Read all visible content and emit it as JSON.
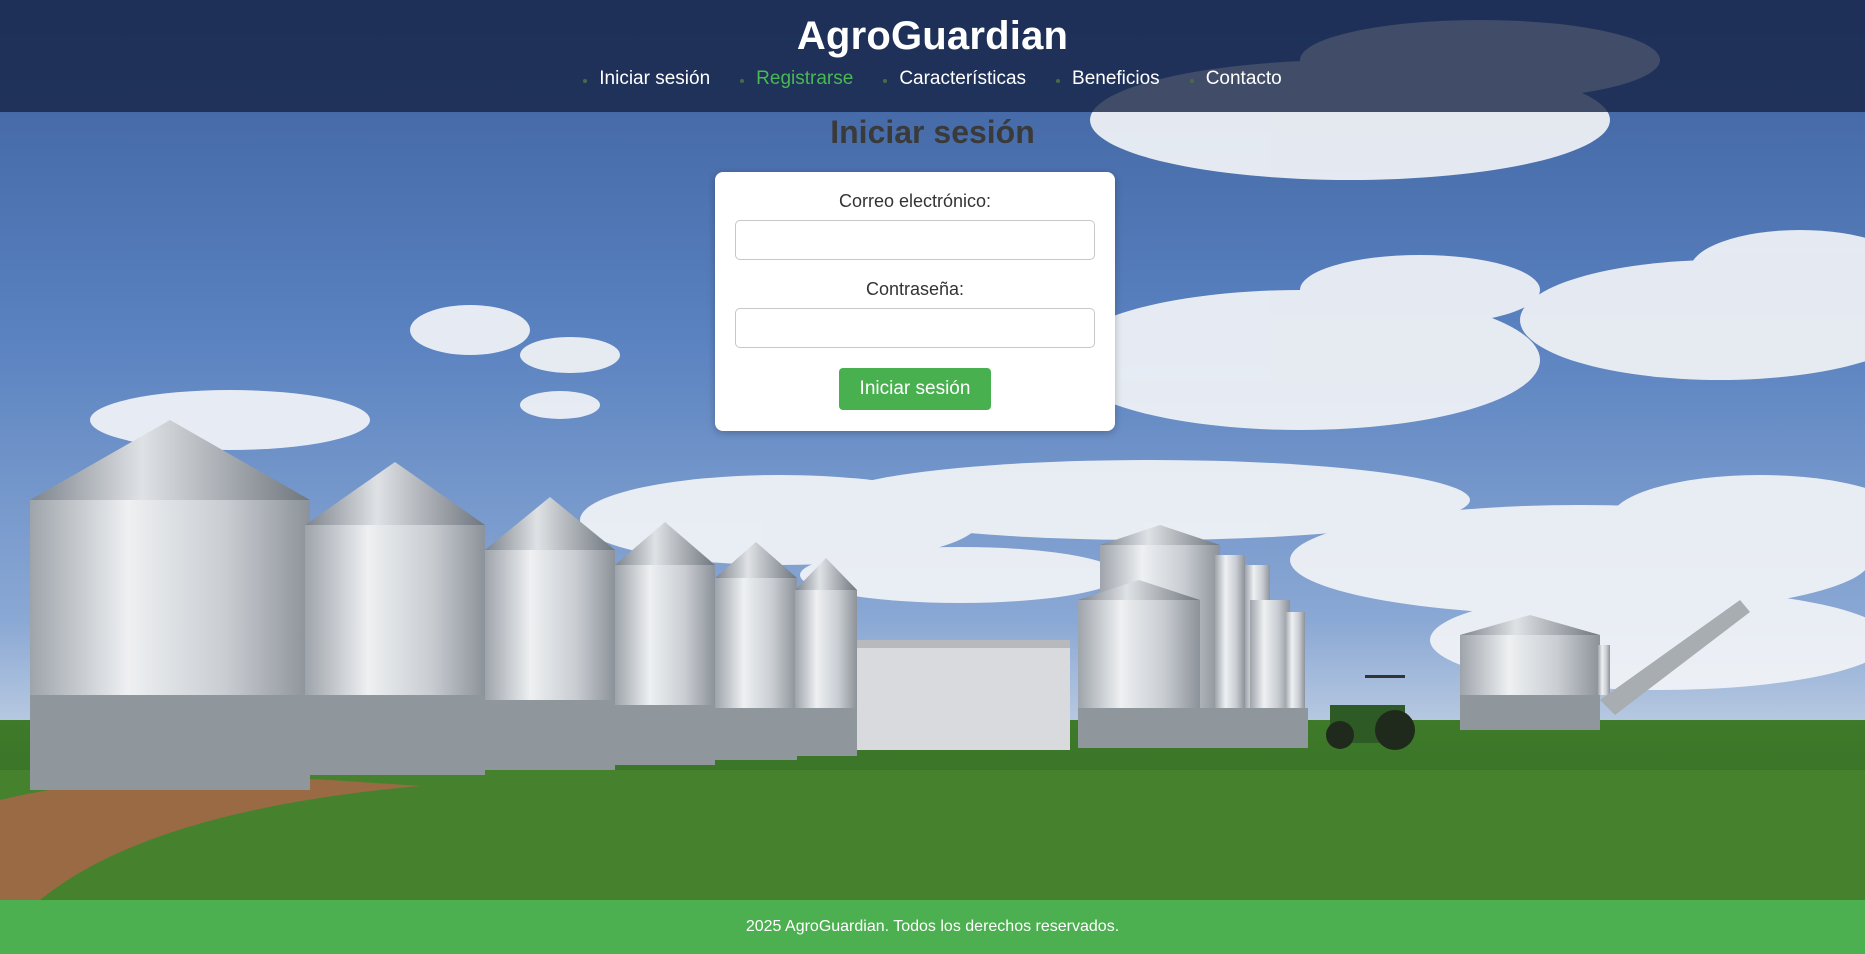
{
  "header": {
    "brand": "AgroGuardian",
    "nav": [
      {
        "label": "Iniciar sesión",
        "active": false
      },
      {
        "label": "Registrarse",
        "active": true
      },
      {
        "label": "Características",
        "active": false
      },
      {
        "label": "Beneficios",
        "active": false
      },
      {
        "label": "Contacto",
        "active": false
      }
    ]
  },
  "login": {
    "title": "Iniciar sesión",
    "email_label": "Correo electrónico:",
    "email_value": "",
    "password_label": "Contraseña:",
    "password_value": "",
    "submit_label": "Iniciar sesión"
  },
  "footer": {
    "text": "2025 AgroGuardian. Todos los derechos reservados."
  },
  "colors": {
    "header_bg": "#162446",
    "accent_green": "#4caf50",
    "active_nav": "#49b853",
    "button_green": "#48b04f"
  }
}
